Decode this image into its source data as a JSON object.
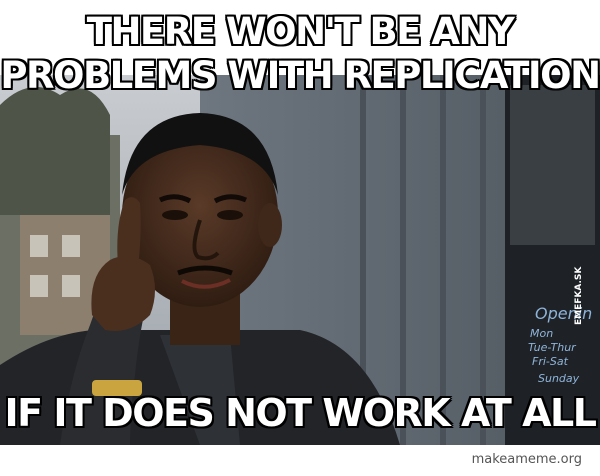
{
  "caption": {
    "top": "THERE WON'T BE ANY PROBLEMS WITH REPLICATION",
    "bottom": "IF IT DOES NOT WORK AT ALL"
  },
  "watermark": {
    "text": "makeameme.org"
  },
  "photo_signage": {
    "side_tag": "EMEFKA.SK",
    "window_sign": [
      "Opening",
      "Mon",
      "Tue-Thur",
      "Fri-Sat",
      "Sunday"
    ]
  },
  "colors": {
    "caption_fill": "#ffffff",
    "caption_outline": "#000000",
    "watermark": "#555555"
  }
}
